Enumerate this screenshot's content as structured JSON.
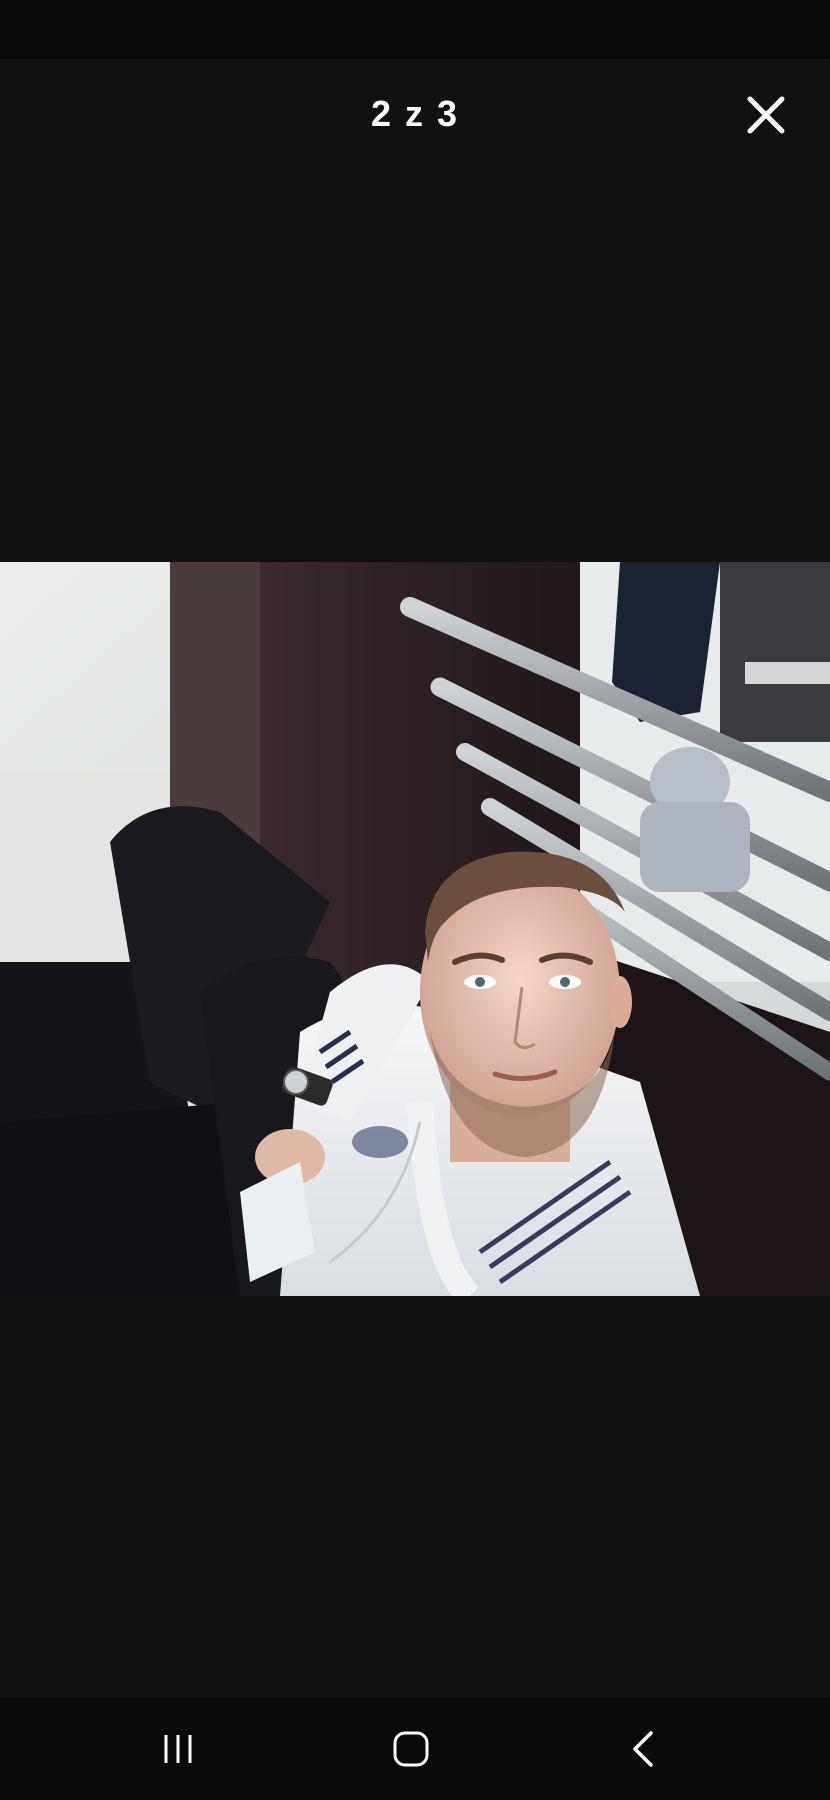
{
  "viewer": {
    "counter": "2 z 3",
    "close_icon": "close-icon"
  },
  "photo": {
    "description_icon": "photo"
  },
  "nav": {
    "recents_icon": "recents-icon",
    "home_icon": "home-icon",
    "back_icon": "back-icon"
  },
  "colors": {
    "background": "#111112",
    "bars": "#0a0a0a",
    "text": "#ffffff"
  }
}
